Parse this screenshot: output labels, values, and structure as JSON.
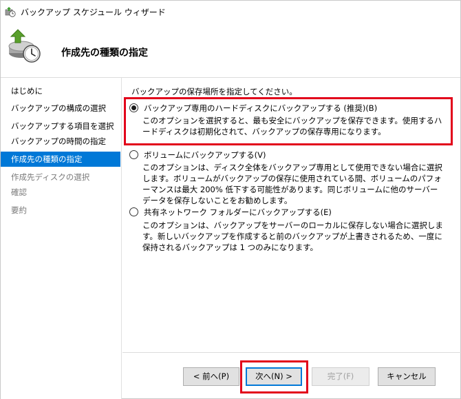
{
  "window": {
    "title": "バックアップ スケジュール ウィザード"
  },
  "header": {
    "page_title": "作成先の種類の指定"
  },
  "nav": {
    "items": [
      {
        "label": "はじめに",
        "state": "normal"
      },
      {
        "label": "バックアップの構成の選択",
        "state": "normal"
      },
      {
        "label": "バックアップする項目を選択",
        "state": "normal"
      },
      {
        "label": "バックアップの時間の指定",
        "state": "normal"
      },
      {
        "label": "作成先の種類の指定",
        "state": "current"
      },
      {
        "label": "作成先ディスクの選択",
        "state": "disabled"
      },
      {
        "label": "確認",
        "state": "disabled"
      },
      {
        "label": "要約",
        "state": "disabled"
      }
    ]
  },
  "main": {
    "intro": "バックアップの保存場所を指定してください。",
    "options": [
      {
        "label": "バックアップ専用のハードディスクにバックアップする (推奨)(B)",
        "checked": true,
        "description": "このオプションを選択すると、最も安全にバックアップを保存できます。使用するハードディスクは初期化されて、バックアップの保存専用になります。"
      },
      {
        "label": "ボリュームにバックアップする(V)",
        "checked": false,
        "description": "このオプションは、ディスク全体をバックアップ専用として使用できない場合に選択します。ボリュームがバックアップの保存に使用されている間、ボリュームのパフォーマンスは最大 200% 低下する可能性があります。同じボリュームに他のサーバー データを保存しないことをお勧めします。"
      },
      {
        "label": "共有ネットワーク フォルダーにバックアップする(E)",
        "checked": false,
        "description": "このオプションは、バックアップをサーバーのローカルに保存しない場合に選択します。新しいバックアップを作成すると前のバックアップが上書きされるため、一度に保持されるバックアップは 1 つのみになります。"
      }
    ]
  },
  "footer": {
    "back_label": "< 前へ(P)",
    "next_label": "次へ(N) >",
    "finish_label": "完了(F)",
    "cancel_label": "キャンセル"
  },
  "colors": {
    "accent": "#0078d7",
    "highlight": "#e2001a",
    "icon_green": "#5aa02c"
  },
  "icons": [
    "backup-schedule-icon",
    "wizard-backup-icon"
  ]
}
